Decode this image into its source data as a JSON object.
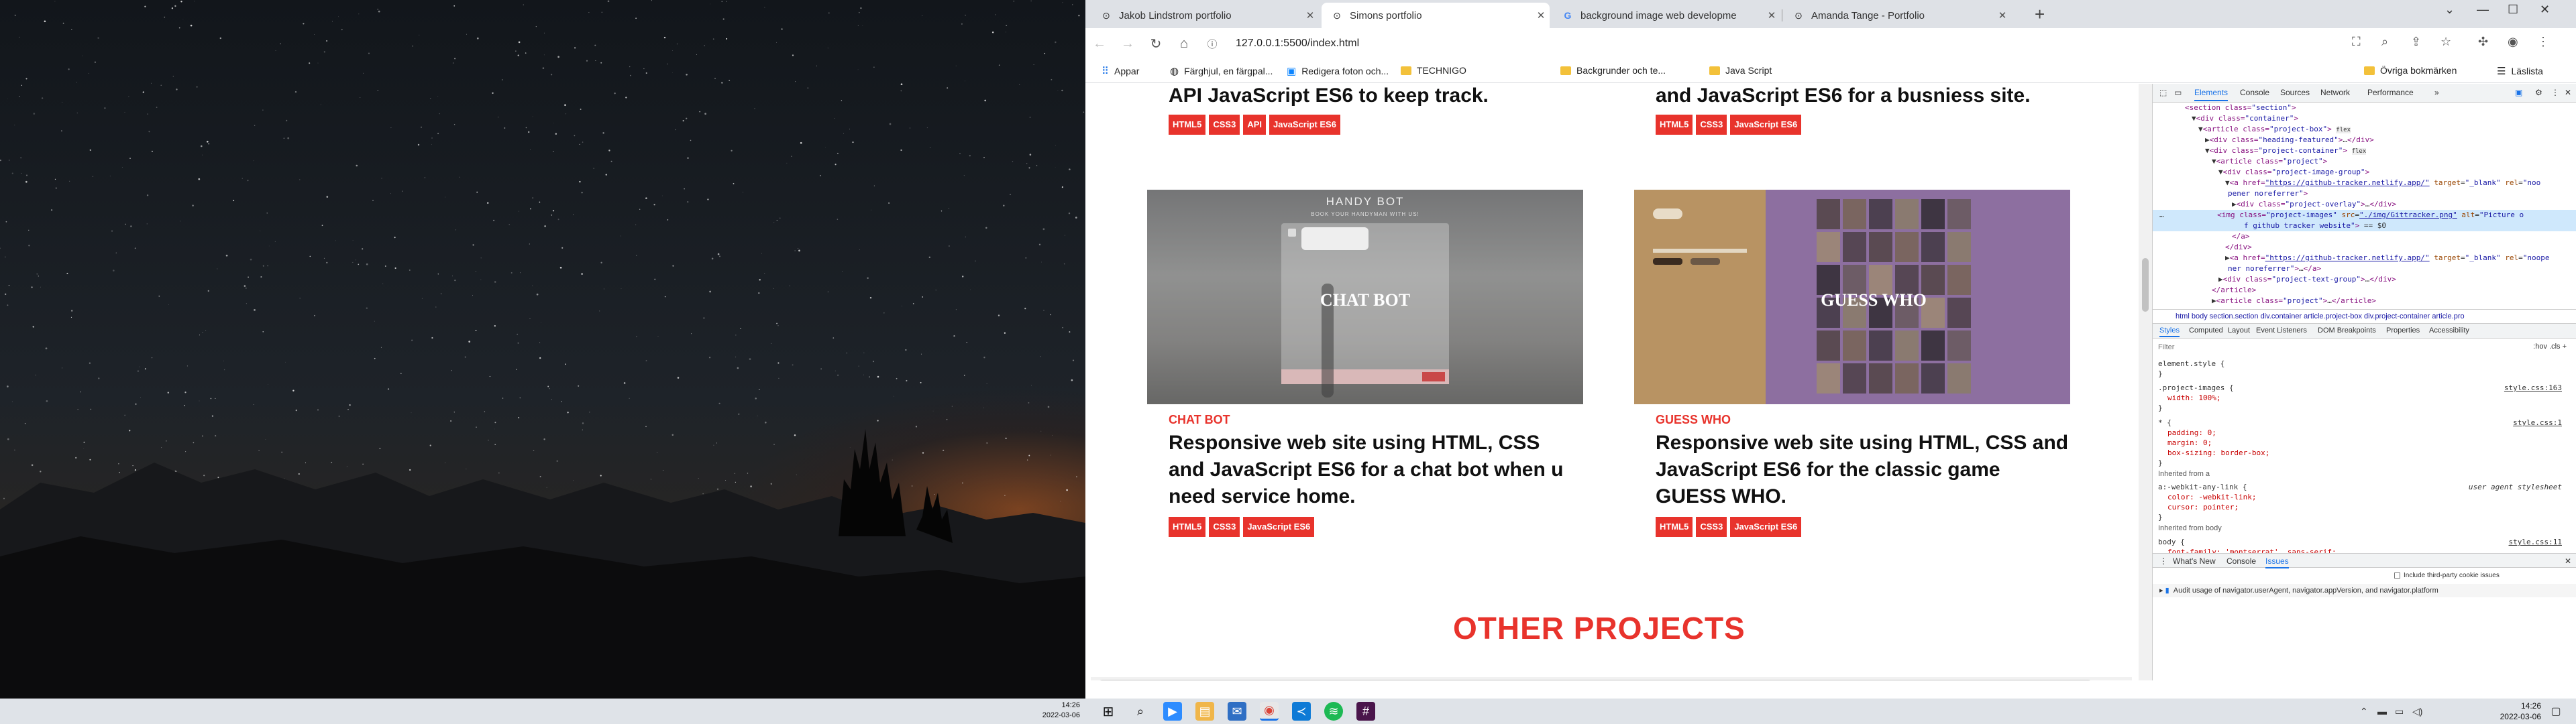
{
  "left_monitor": {
    "clock_time": "14:26",
    "clock_date": "2022-03-06"
  },
  "browser": {
    "tabs": [
      {
        "label": "Jakob Lindstrom portfolio",
        "icon": "github-icon",
        "active": false
      },
      {
        "label": "Simons portfolio",
        "icon": "github-icon",
        "active": true
      },
      {
        "label": "background image web developme",
        "icon": "google-icon",
        "active": false
      },
      {
        "label": "Amanda Tange - Portfolio",
        "icon": "github-icon",
        "active": false
      }
    ],
    "new_tab": "+",
    "url": "127.0.0.1:5500/index.html",
    "bookmarks": [
      {
        "label": "Appar",
        "icon": "apps-grid-icon"
      },
      {
        "label": "Färghjul, en färgpal...",
        "icon": "color-wheel-icon"
      },
      {
        "label": "Redigera foton och...",
        "icon": "photo-icon"
      },
      {
        "label": "TECHNIGO",
        "icon": "folder-icon"
      },
      {
        "label": "Backgrunder och te...",
        "icon": "folder-icon"
      },
      {
        "label": "Java Script",
        "icon": "folder-icon"
      }
    ],
    "other_bookmarks": "Övriga bokmärken",
    "reading_list": "Läslista"
  },
  "page": {
    "top_left": {
      "title_tail": "API JavaScript ES6 to keep track.",
      "tags": [
        "HTML5",
        "CSS3",
        "API",
        "JavaScript ES6"
      ]
    },
    "top_right": {
      "title_tail": "and JavaScript ES6 for a busniess site.",
      "tags": [
        "HTML5",
        "CSS3",
        "JavaScript ES6"
      ]
    },
    "card_left": {
      "image_heading": "HANDY BOT",
      "image_subheading": "BOOK YOUR HANDYMAN WITH US!",
      "overlay": "CHAT BOT",
      "category": "CHAT BOT",
      "description": "Responsive web site using HTML, CSS and JavaScript ES6 for a chat bot when u need service home.",
      "tags": [
        "HTML5",
        "CSS3",
        "JavaScript ES6"
      ]
    },
    "card_right": {
      "overlay": "GUESS WHO",
      "category": "GUESS WHO",
      "description": "Responsive web site using HTML, CSS and JavaScript ES6 for the classic game GUESS WHO.",
      "tags": [
        "HTML5",
        "CSS3",
        "JavaScript ES6"
      ]
    },
    "section_heading": "OTHER PROJECTS"
  },
  "devtools": {
    "tabs": [
      "Elements",
      "Console",
      "Sources",
      "Network",
      "Performance"
    ],
    "breadcrumb": "html  body  section.section  div.container  article.project-box  div.project-container  article.pro",
    "styles_tabs": [
      "Styles",
      "Computed",
      "Layout",
      "Event Listeners",
      "DOM Breakpoints",
      "Properties",
      "Accessibility"
    ],
    "filter_placeholder": "Filter",
    "filter_right": ":hov  .cls  +",
    "rules": {
      "element_style": "element.style {",
      "project_images": ".project-images {",
      "project_images_prop": "width: 100%;",
      "project_images_src": "style.css:163",
      "universal": "* {",
      "universal_src": "style.css:1",
      "universal_props": [
        "padding: 0;",
        "margin: 0;",
        "box-sizing: border-box;"
      ],
      "inherited_a": "Inherited from a",
      "link_rule": "a:-webkit-any-link {",
      "link_src": "user agent stylesheet",
      "link_props": [
        "color: -webkit-link;",
        "cursor: pointer;"
      ],
      "inherited_body": "Inherited from body",
      "body_rule": "body {",
      "body_src": "style.css:11",
      "body_prop": "font-family: 'montserrat', sans-serif;"
    },
    "drawer_tabs": [
      "What's New",
      "Console",
      "Issues"
    ],
    "third_party": "Include third-party cookie issues",
    "issue": "Audit usage of navigator.userAgent, navigator.appVersion, and navigator.platform"
  },
  "taskbar": {
    "time": "14:26",
    "date": "2022-03-06"
  }
}
